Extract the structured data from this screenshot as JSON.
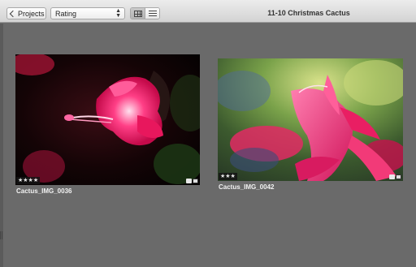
{
  "toolbar": {
    "back_label": "Projects",
    "sort_value": "Rating",
    "window_title": "11-10 Christmas Cactus"
  },
  "photos": [
    {
      "name": "Cactus_IMG_0036",
      "stars": "★★★★",
      "rating": 4
    },
    {
      "name": "Cactus_IMG_0042",
      "stars": "★★★",
      "rating": 3
    }
  ]
}
